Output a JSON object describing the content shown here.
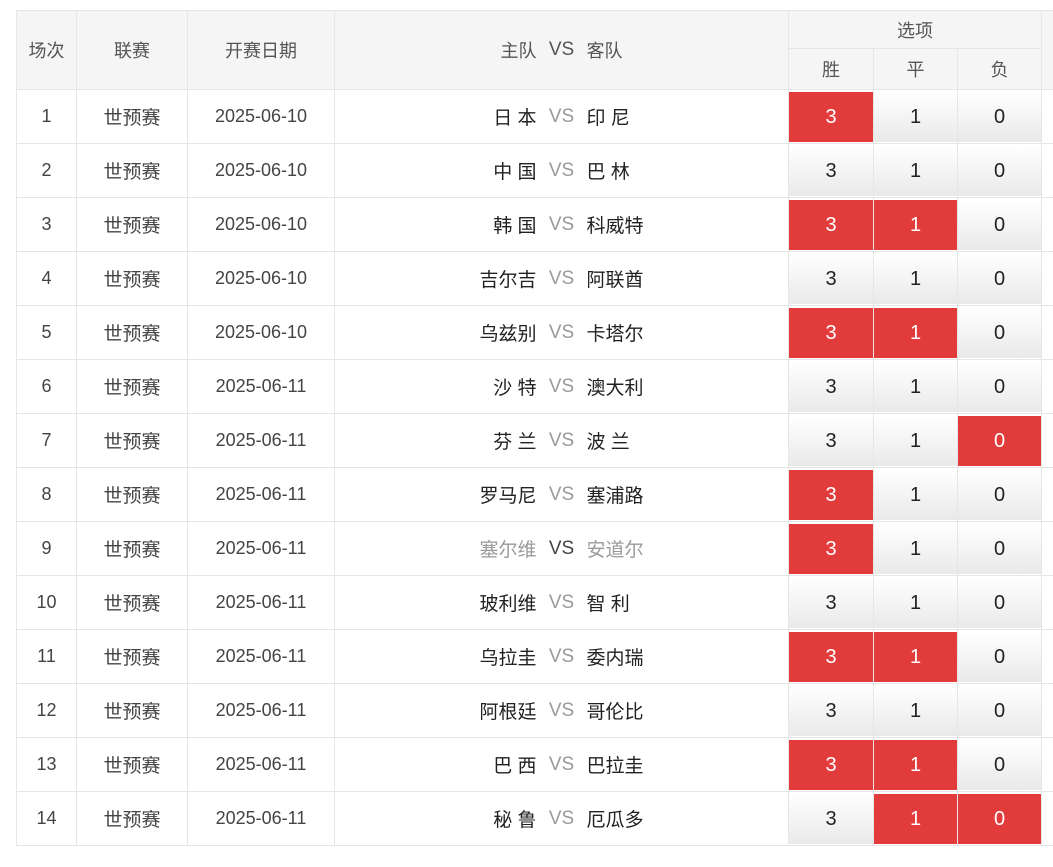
{
  "headers": {
    "index": "场次",
    "league": "联赛",
    "date": "开赛日期",
    "home": "主队",
    "vs": "VS",
    "away": "客队",
    "options": "选项",
    "win": "胜",
    "draw": "平",
    "lose": "负"
  },
  "colors": {
    "selected": "#e23b3b",
    "border": "#e6e6e6",
    "header_bg": "#f5f5f5"
  },
  "rows": [
    {
      "index": "1",
      "league": "世预赛",
      "date": "2025-06-10",
      "home": "日 本",
      "vs": "VS",
      "away": "印 尼",
      "win": "3",
      "draw": "1",
      "lose": "0",
      "sel": [
        true,
        false,
        false
      ]
    },
    {
      "index": "2",
      "league": "世预赛",
      "date": "2025-06-10",
      "home": "中 国",
      "vs": "VS",
      "away": "巴 林",
      "win": "3",
      "draw": "1",
      "lose": "0",
      "sel": [
        false,
        false,
        false
      ]
    },
    {
      "index": "3",
      "league": "世预赛",
      "date": "2025-06-10",
      "home": "韩 国",
      "vs": "VS",
      "away": "科威特",
      "win": "3",
      "draw": "1",
      "lose": "0",
      "sel": [
        true,
        true,
        false
      ]
    },
    {
      "index": "4",
      "league": "世预赛",
      "date": "2025-06-10",
      "home": "吉尔吉",
      "vs": "VS",
      "away": "阿联酋",
      "win": "3",
      "draw": "1",
      "lose": "0",
      "sel": [
        false,
        false,
        false
      ]
    },
    {
      "index": "5",
      "league": "世预赛",
      "date": "2025-06-10",
      "home": "乌兹别",
      "vs": "VS",
      "away": "卡塔尔",
      "win": "3",
      "draw": "1",
      "lose": "0",
      "sel": [
        true,
        true,
        false
      ]
    },
    {
      "index": "6",
      "league": "世预赛",
      "date": "2025-06-11",
      "home": "沙 特",
      "vs": "VS",
      "away": "澳大利",
      "win": "3",
      "draw": "1",
      "lose": "0",
      "sel": [
        false,
        false,
        false
      ]
    },
    {
      "index": "7",
      "league": "世预赛",
      "date": "2025-06-11",
      "home": "芬 兰",
      "vs": "VS",
      "away": "波 兰",
      "win": "3",
      "draw": "1",
      "lose": "0",
      "sel": [
        false,
        false,
        true
      ]
    },
    {
      "index": "8",
      "league": "世预赛",
      "date": "2025-06-11",
      "home": "罗马尼",
      "vs": "VS",
      "away": "塞浦路",
      "win": "3",
      "draw": "1",
      "lose": "0",
      "sel": [
        true,
        false,
        false
      ]
    },
    {
      "index": "9",
      "league": "世预赛",
      "date": "2025-06-11",
      "home": "塞尔维",
      "vs": "VS",
      "away": "安道尔",
      "win": "3",
      "draw": "1",
      "lose": "0",
      "sel": [
        true,
        false,
        false
      ],
      "dim": true
    },
    {
      "index": "10",
      "league": "世预赛",
      "date": "2025-06-11",
      "home": "玻利维",
      "vs": "VS",
      "away": "智 利",
      "win": "3",
      "draw": "1",
      "lose": "0",
      "sel": [
        false,
        false,
        false
      ]
    },
    {
      "index": "11",
      "league": "世预赛",
      "date": "2025-06-11",
      "home": "乌拉圭",
      "vs": "VS",
      "away": "委内瑞",
      "win": "3",
      "draw": "1",
      "lose": "0",
      "sel": [
        true,
        true,
        false
      ]
    },
    {
      "index": "12",
      "league": "世预赛",
      "date": "2025-06-11",
      "home": "阿根廷",
      "vs": "VS",
      "away": "哥伦比",
      "win": "3",
      "draw": "1",
      "lose": "0",
      "sel": [
        false,
        false,
        false
      ]
    },
    {
      "index": "13",
      "league": "世预赛",
      "date": "2025-06-11",
      "home": "巴 西",
      "vs": "VS",
      "away": "巴拉圭",
      "win": "3",
      "draw": "1",
      "lose": "0",
      "sel": [
        true,
        true,
        false
      ]
    },
    {
      "index": "14",
      "league": "世预赛",
      "date": "2025-06-11",
      "home": "秘 鲁",
      "vs": "VS",
      "away": "厄瓜多",
      "win": "3",
      "draw": "1",
      "lose": "0",
      "sel": [
        false,
        true,
        true
      ]
    }
  ]
}
